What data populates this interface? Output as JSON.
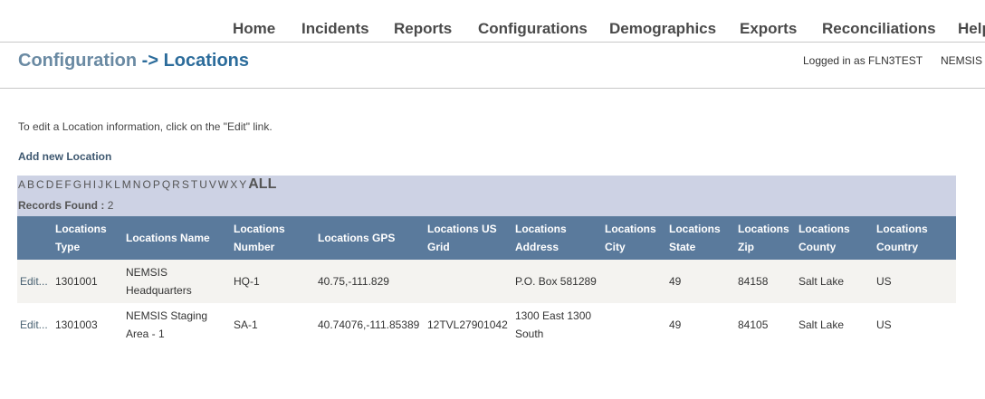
{
  "nav": {
    "items": [
      "Home",
      "Incidents",
      "Reports",
      "Configurations",
      "Demographics",
      "Exports",
      "Reconciliations",
      "Help"
    ]
  },
  "header": {
    "breadcrumb_parent": "Configuration",
    "breadcrumb_separator": "->",
    "breadcrumb_current": "Locations",
    "logged_in_text": "Logged in as FLN3TEST",
    "system_name": "NEMSIS"
  },
  "content": {
    "instructions": "To edit a Location information, click on the \"Edit\" link.",
    "add_link": "Add new Location"
  },
  "filter": {
    "letters": [
      "A",
      "B",
      "C",
      "D",
      "E",
      "F",
      "G",
      "H",
      "I",
      "J",
      "K",
      "L",
      "M",
      "N",
      "O",
      "P",
      "Q",
      "R",
      "S",
      "T",
      "U",
      "V",
      "W",
      "X",
      "Y"
    ],
    "all_label": "ALL",
    "records_label": "Records Found :",
    "records_count": "2"
  },
  "table": {
    "columns": [
      "",
      "Locations Type",
      "Locations Name",
      "Locations Number",
      "Locations GPS",
      "Locations US Grid",
      "Locations Address",
      "Locations City",
      "Locations State",
      "Locations Zip",
      "Locations County",
      "Locations Country"
    ],
    "rows": [
      [
        "Edit...",
        "1301001",
        "NEMSIS Headquarters",
        "HQ-1",
        "40.75,-111.829",
        "",
        "P.O. Box 581289",
        "",
        "49",
        "84158",
        "Salt Lake",
        "US"
      ],
      [
        "Edit...",
        "1301003",
        "NEMSIS Staging Area - 1",
        "SA-1",
        "40.74076,-111.85389",
        "12TVL27901042",
        "1300 East 1300 South",
        "",
        "49",
        "84105",
        "Salt Lake",
        "US"
      ]
    ]
  }
}
